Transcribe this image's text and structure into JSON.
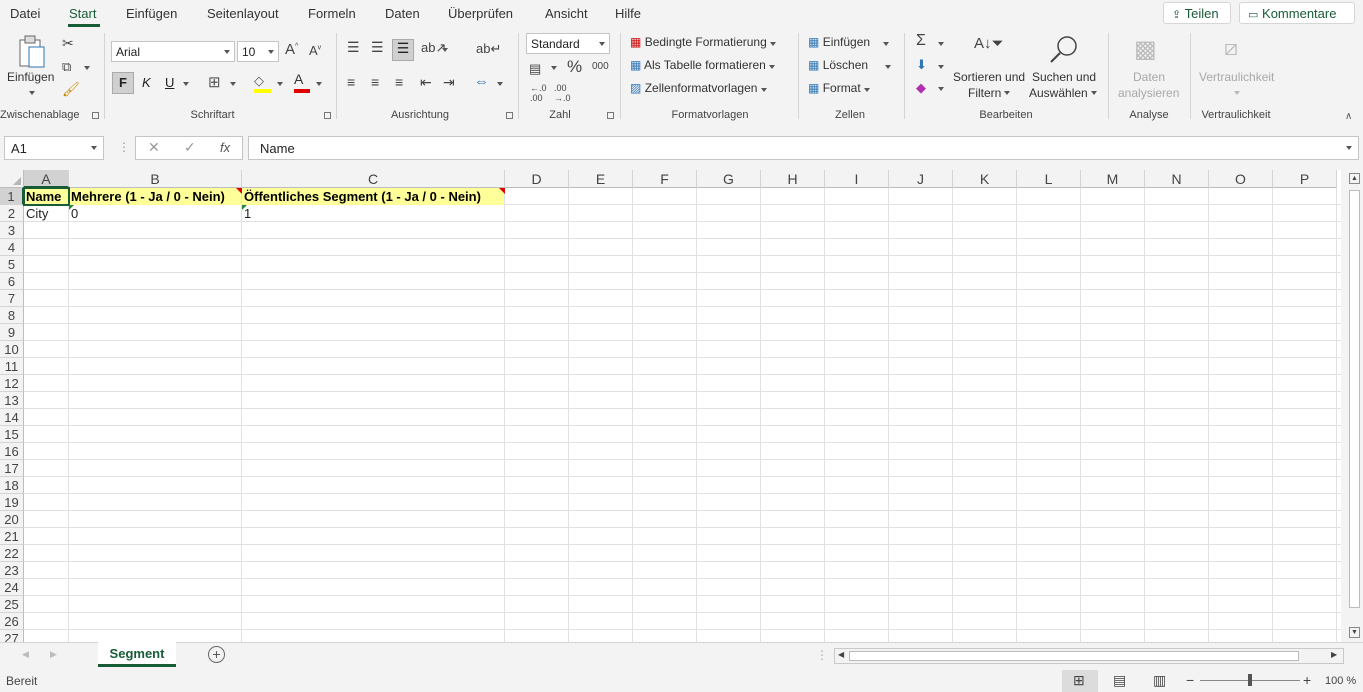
{
  "menu": {
    "tabs": [
      "Datei",
      "Start",
      "Einfügen",
      "Seitenlayout",
      "Formeln",
      "Daten",
      "Überprüfen",
      "Ansicht",
      "Hilfe"
    ],
    "share": "Teilen",
    "comments": "Kommentare"
  },
  "ribbon": {
    "clipboard": {
      "paste": "Einfügen",
      "label": "Zwischenablage"
    },
    "font": {
      "name": "Arial",
      "size": "10",
      "bold": "F",
      "italic": "K",
      "underline": "U",
      "label": "Schriftart"
    },
    "alignment": {
      "label": "Ausrichtung"
    },
    "number": {
      "format": "Standard",
      "percent": "%",
      "thousands": "000",
      "label": "Zahl"
    },
    "styles": {
      "conditional": "Bedingte Formatierung",
      "as_table": "Als Tabelle formatieren",
      "cell_styles": "Zellenformatvorlagen",
      "label": "Formatvorlagen"
    },
    "cells": {
      "insert": "Einfügen",
      "delete": "Löschen",
      "format": "Format",
      "label": "Zellen"
    },
    "editing": {
      "sort_line1": "Sortieren und",
      "sort_line2": "Filtern",
      "find_line1": "Suchen und",
      "find_line2": "Auswählen",
      "label": "Bearbeiten"
    },
    "analysis": {
      "line1": "Daten",
      "line2": "analysieren",
      "label": "Analyse"
    },
    "sensitivity": {
      "button": "Vertraulichkeit",
      "label": "Vertraulichkeit"
    }
  },
  "formula_bar": {
    "name_box": "A1",
    "fx": "fx",
    "value": "Name"
  },
  "columns": [
    "A",
    "B",
    "C",
    "D",
    "E",
    "F",
    "G",
    "H",
    "I",
    "J",
    "K",
    "L",
    "M",
    "N",
    "O",
    "P"
  ],
  "rows": [
    "1",
    "2",
    "3",
    "4",
    "5",
    "6",
    "7",
    "8",
    "9",
    "10",
    "11",
    "12",
    "13",
    "14",
    "15",
    "16",
    "17",
    "18",
    "19",
    "20",
    "21",
    "22",
    "23",
    "24",
    "25",
    "26",
    "27"
  ],
  "cells": {
    "A1": "Name",
    "B1": "Mehrere (1 - Ja / 0 - Nein)",
    "C1": "Öffentliches Segment (1 - Ja / 0 - Nein)",
    "A2": "City",
    "B2": "0",
    "C2": "1"
  },
  "sheets": [
    "Segment"
  ],
  "status": {
    "ready": "Bereit",
    "zoom": "100 %"
  },
  "colors": {
    "accent": "#185c37",
    "header_fill": "#ffff99"
  }
}
